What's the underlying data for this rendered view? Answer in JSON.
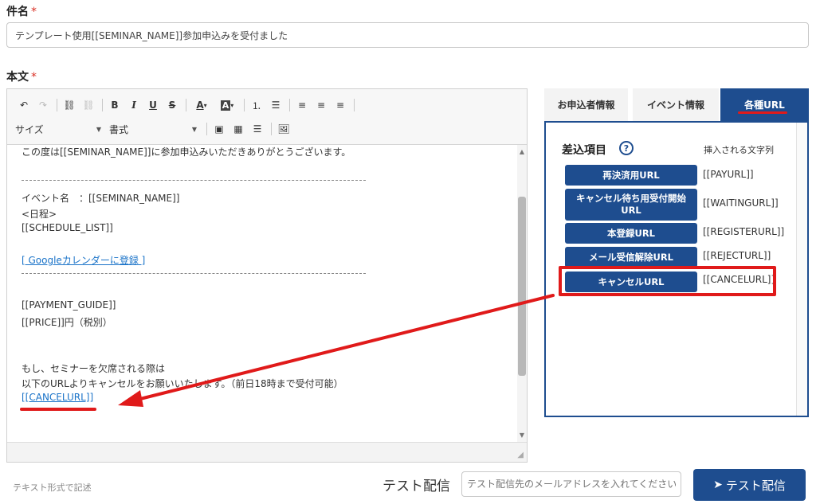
{
  "subject": {
    "label": "件名",
    "required_mark": "*",
    "value": "テンプレート使用[[SEMINAR_NAME]]参加申込みを受付ました"
  },
  "body": {
    "label": "本文",
    "required_mark": "*",
    "toolbar": {
      "size_select": "サイズ",
      "format_select": "書式"
    },
    "lines": {
      "l1": "この度は[[SEMINAR_NAME]]に参加申込みいただきありがとうございます。",
      "l2": "イベント名　：[[SEMINAR_NAME]]",
      "l3": "<日程>",
      "l4": " [[SCHEDULE_LIST]]",
      "l5": "[ Googleカレンダーに登録 ]",
      "l6": "[[PAYMENT_GUIDE]]",
      "l7": "[[PRICE]]円（税別）",
      "l8": "もし、セミナーを欠席される際は",
      "l9": "以下のURLよりキャンセルをお願いいたします。（前日18時まで受付可能）",
      "l10": "[[CANCELURL]]"
    }
  },
  "tabs": [
    {
      "label": "お申込者情報",
      "active": false
    },
    {
      "label": "イベント情報",
      "active": false
    },
    {
      "label": "各種URL",
      "active": true
    }
  ],
  "panel": {
    "title": "差込項目",
    "help": "?",
    "inserted_text_header": "挿入される文字列",
    "items": [
      {
        "button": "再決済用URL",
        "value": "[[PAYURL]]"
      },
      {
        "button": "キャンセル待ち用受付開始URL",
        "value": "[[WAITINGURL]]"
      },
      {
        "button": "本登録URL",
        "value": "[[REGISTERURL]]"
      },
      {
        "button": "メール受信解除URL",
        "value": "[[REJECTURL]]"
      },
      {
        "button": "キャンセルURL",
        "value": "[[CANCELURL]]"
      }
    ]
  },
  "footer": {
    "format_note": "テキスト形式で記述",
    "test_label": "テスト配信",
    "test_placeholder": "テスト配信先のメールアドレスを入れてください",
    "test_button": "テスト配信"
  },
  "colors": {
    "primary": "#1e4d8f",
    "annotation": "#e01a1a",
    "link": "#1a73c8"
  }
}
